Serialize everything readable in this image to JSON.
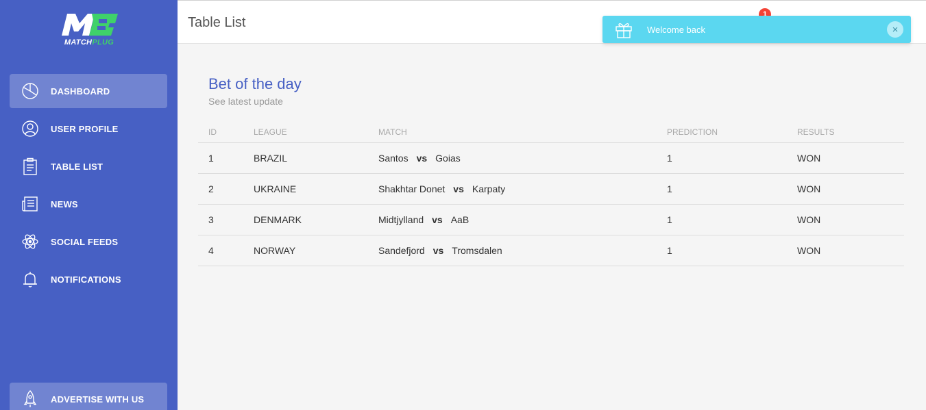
{
  "brand": {
    "name_part1": "MATCH",
    "name_part2": "PLUG",
    "primary_color": "#4760c4",
    "accent_color": "#3fd16a"
  },
  "sidebar": {
    "items": [
      {
        "label": "DASHBOARD",
        "icon": "pie-chart-icon",
        "active": true
      },
      {
        "label": "USER PROFILE",
        "icon": "user-icon",
        "active": false
      },
      {
        "label": "TABLE LIST",
        "icon": "clipboard-icon",
        "active": false
      },
      {
        "label": "NEWS",
        "icon": "newspaper-icon",
        "active": false
      },
      {
        "label": "SOCIAL FEEDS",
        "icon": "atom-icon",
        "active": false
      },
      {
        "label": "NOTIFICATIONS",
        "icon": "bell-icon",
        "active": false
      }
    ],
    "advertise_label": "ADVERTISE WITH US"
  },
  "header": {
    "title": "Table List",
    "notification_count": "1"
  },
  "toast": {
    "message": "Welcome back",
    "close_label": "×",
    "color": "#5bd7f0"
  },
  "card": {
    "title": "Bet of the day",
    "subtitle": "See latest update",
    "columns": [
      "ID",
      "LEAGUE",
      "MATCH",
      "PREDICTION",
      "RESULTS"
    ],
    "vs_label": "vs",
    "rows": [
      {
        "id": "1",
        "league": "BRAZIL",
        "home": "Santos",
        "away": "Goias",
        "prediction": "1",
        "result": "WON"
      },
      {
        "id": "2",
        "league": "UKRAINE",
        "home": "Shakhtar Donet",
        "away": "Karpaty",
        "prediction": "1",
        "result": "WON"
      },
      {
        "id": "3",
        "league": "DENMARK",
        "home": "Midtjylland",
        "away": "AaB",
        "prediction": "1",
        "result": "WON"
      },
      {
        "id": "4",
        "league": "NORWAY",
        "home": "Sandefjord",
        "away": "Tromsdalen",
        "prediction": "1",
        "result": "WON"
      }
    ]
  }
}
